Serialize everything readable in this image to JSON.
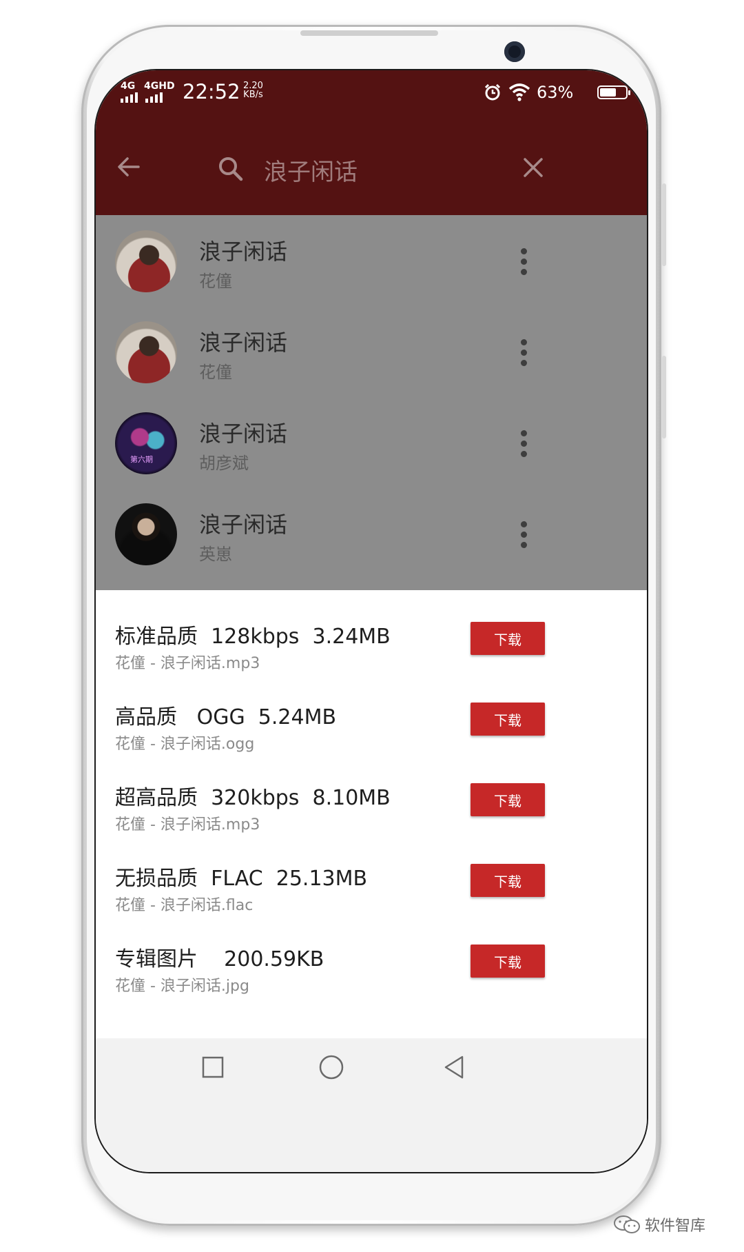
{
  "status_bar": {
    "signal_1": "4G",
    "signal_2": "4GHD",
    "time": "22:52",
    "net_speed_value": "2.20",
    "net_speed_unit": "KB/s",
    "battery_percent": "63%",
    "battery_level": 0.63,
    "icons": [
      "alarm-icon",
      "wifi-icon",
      "battery-icon"
    ]
  },
  "toolbar": {
    "query": "浪子闲话",
    "icons": [
      "back-arrow-icon",
      "search-icon",
      "close-icon"
    ]
  },
  "results": [
    {
      "title": "浪子闲话",
      "artist": "花僮"
    },
    {
      "title": "浪子闲话",
      "artist": "花僮"
    },
    {
      "title": "浪子闲话",
      "artist": "胡彦斌",
      "cover_text": "第六期"
    },
    {
      "title": "浪子闲话",
      "artist": "英崽"
    }
  ],
  "download_options": [
    {
      "title": "标准品质  128kbps  3.24MB",
      "file": "花僮 - 浪子闲话.mp3",
      "button": "下载"
    },
    {
      "title": "高品质   OGG  5.24MB",
      "file": "花僮 - 浪子闲话.ogg",
      "button": "下载"
    },
    {
      "title": "超高品质  320kbps  8.10MB",
      "file": "花僮 - 浪子闲话.mp3",
      "button": "下载"
    },
    {
      "title": "无损品质  FLAC  25.13MB",
      "file": "花僮 - 浪子闲话.flac",
      "button": "下载"
    },
    {
      "title": "专辑图片    200.59KB",
      "file": "花僮 - 浪子闲话.jpg",
      "button": "下载"
    }
  ],
  "nav_bar": {
    "icons": [
      "recents-square-icon",
      "home-circle-icon",
      "back-triangle-icon"
    ]
  },
  "watermark": {
    "text": "软件智库"
  },
  "colors": {
    "toolbar": "#541212",
    "dim_overlay": "#8c8c8c",
    "download_button": "#c62828"
  }
}
